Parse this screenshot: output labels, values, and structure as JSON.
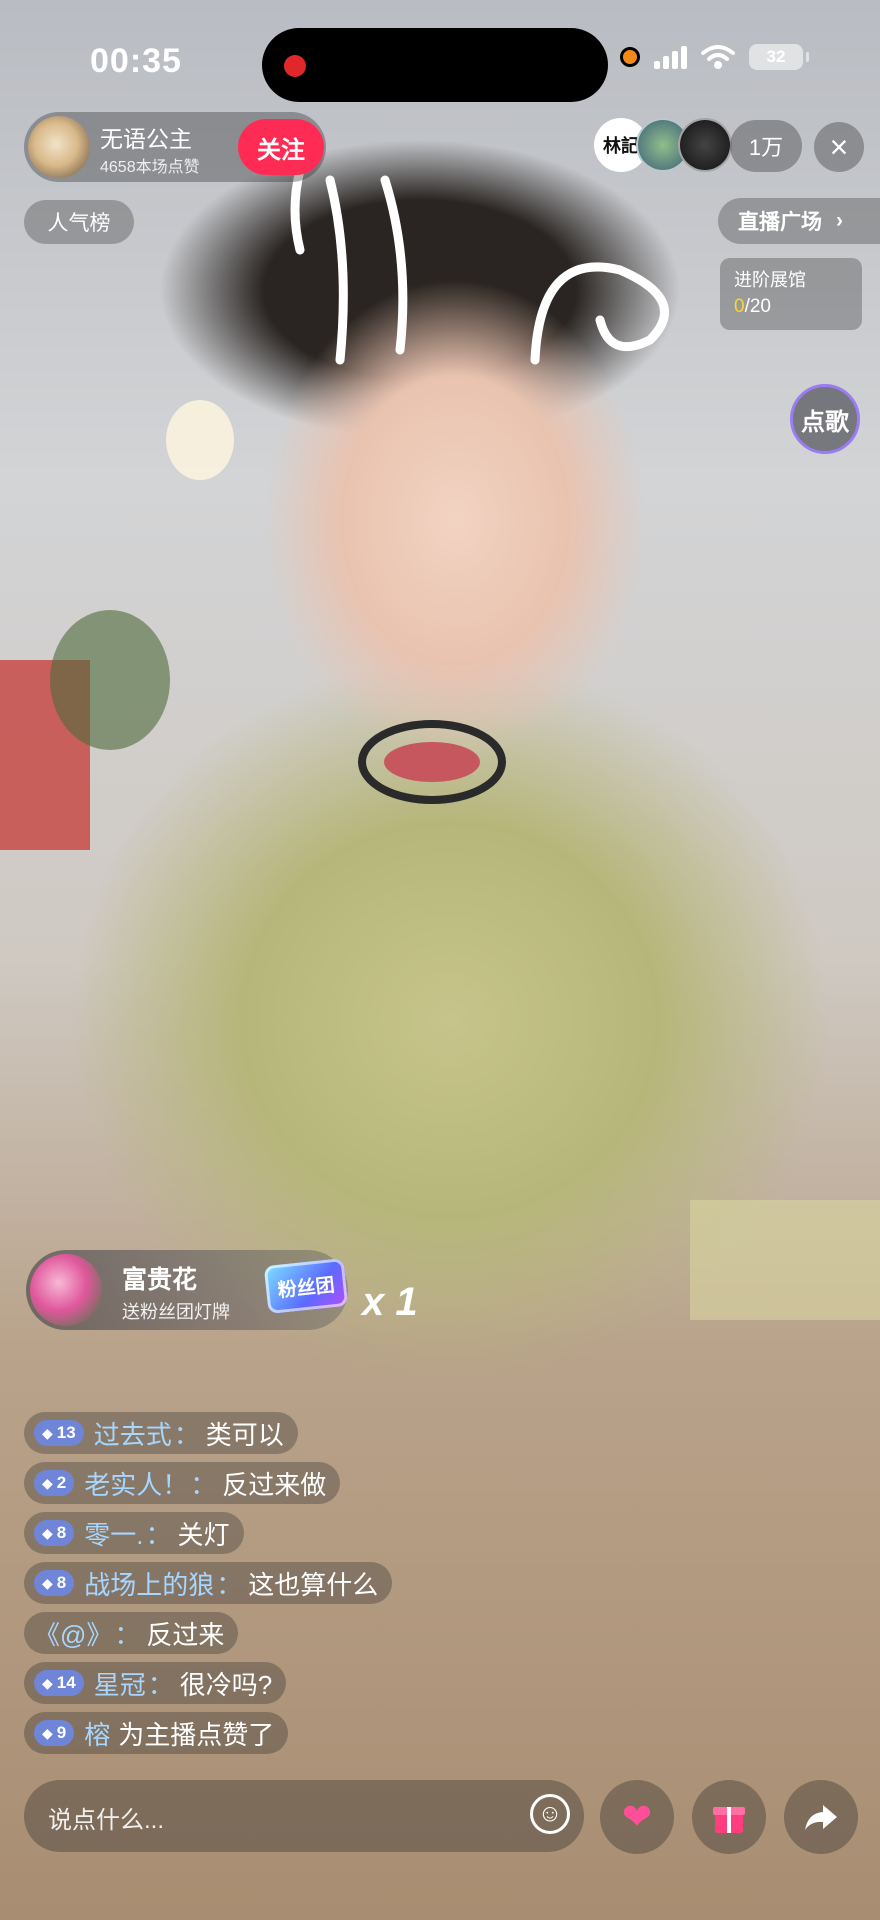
{
  "status_bar": {
    "time": "00:35",
    "battery": "32"
  },
  "host": {
    "name": "无语公主",
    "likes": "4658本场点赞",
    "follow_label": "关注"
  },
  "top_right": {
    "viewer_badge_text": "林記",
    "viewer_count": "1万",
    "close_icon": "×"
  },
  "popularity_label": "人气榜",
  "live_square_label": "直播广场",
  "gallery": {
    "title": "进阶展馆",
    "current": "0",
    "total": "/20"
  },
  "song_request_label": "点歌",
  "gift_banner": {
    "sender": "富贵花",
    "description": "送粉丝团灯牌",
    "badge": "粉丝团",
    "count": "x 1"
  },
  "comments": [
    {
      "level": "13",
      "user": "过去式",
      "sep": "：",
      "text": "类可以"
    },
    {
      "level": "2",
      "user": "老实人！",
      "sep": "：",
      "text": "反过来做"
    },
    {
      "level": "8",
      "user": "零一.",
      "sep": "：",
      "text": "关灯"
    },
    {
      "level": "8",
      "user": "战场上的狼",
      "sep": "：",
      "text": "这也算什么"
    },
    {
      "level": "",
      "user": "《@》",
      "sep": "：",
      "text": "反过来"
    },
    {
      "level": "14",
      "user": "星冠",
      "sep": "：",
      "text": "很冷吗?"
    },
    {
      "level": "9",
      "user": "榕",
      "sep": " ",
      "text": "为主播点赞了"
    }
  ],
  "input": {
    "placeholder": "说点什么..."
  },
  "icons": {
    "emoji": "smile-icon",
    "heart": "heart-planet-icon",
    "gift": "gift-icon",
    "share": "share-arrow-icon"
  }
}
